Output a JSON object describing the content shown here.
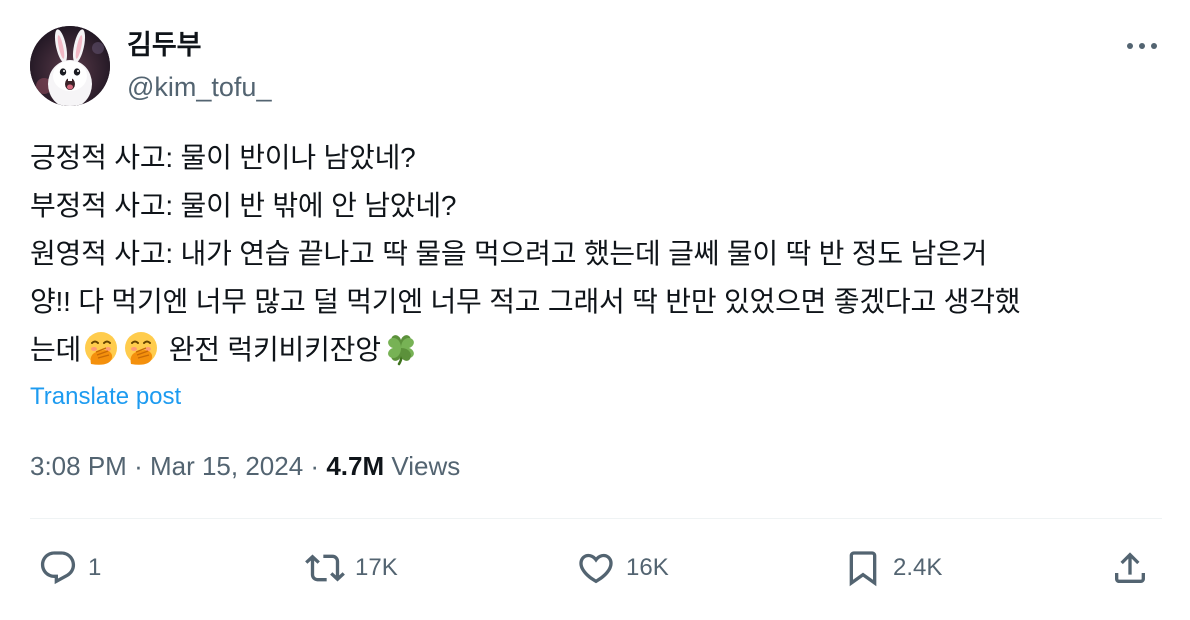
{
  "author": {
    "name": "김두부",
    "handle": "@kim_tofu_"
  },
  "post": {
    "lines": [
      "긍정적 사고: 물이 반이나 남았네?",
      "부정적 사고: 물이 반 밖에 안 남았네?",
      "원영적 사고: 내가 연습 끝나고 딱 물을 먹으려고 했는데 글쎄 물이 딱 반 정도 남은거",
      "양!! 다 먹기엔 너무 많고 덜 먹기엔 너무 적고 그래서 딱 반만 있었으면 좋겠다고 생각했",
      "는데"
    ],
    "last_line_tail": "완전 럭키비키잔앙",
    "translate_label": "Translate post"
  },
  "meta": {
    "time": "3:08 PM",
    "separator": "·",
    "date": "Mar 15, 2024",
    "views_count": "4.7M",
    "views_label": "Views"
  },
  "actions": {
    "reply_count": "1",
    "repost_count": "17K",
    "like_count": "16K",
    "bookmark_count": "2.4K"
  },
  "icons": {
    "more": "more-horizontal-icon",
    "reply": "reply-icon",
    "repost": "repost-icon",
    "like": "heart-icon",
    "bookmark": "bookmark-icon",
    "share": "share-icon",
    "emoji_1": "face-with-hand-over-mouth-emoji",
    "emoji_2": "face-with-hand-over-mouth-emoji",
    "emoji_3": "four-leaf-clover-emoji"
  },
  "colors": {
    "text": "#0f1419",
    "secondary": "#536471",
    "link": "#1d9bf0",
    "divider": "#eff3f4"
  }
}
